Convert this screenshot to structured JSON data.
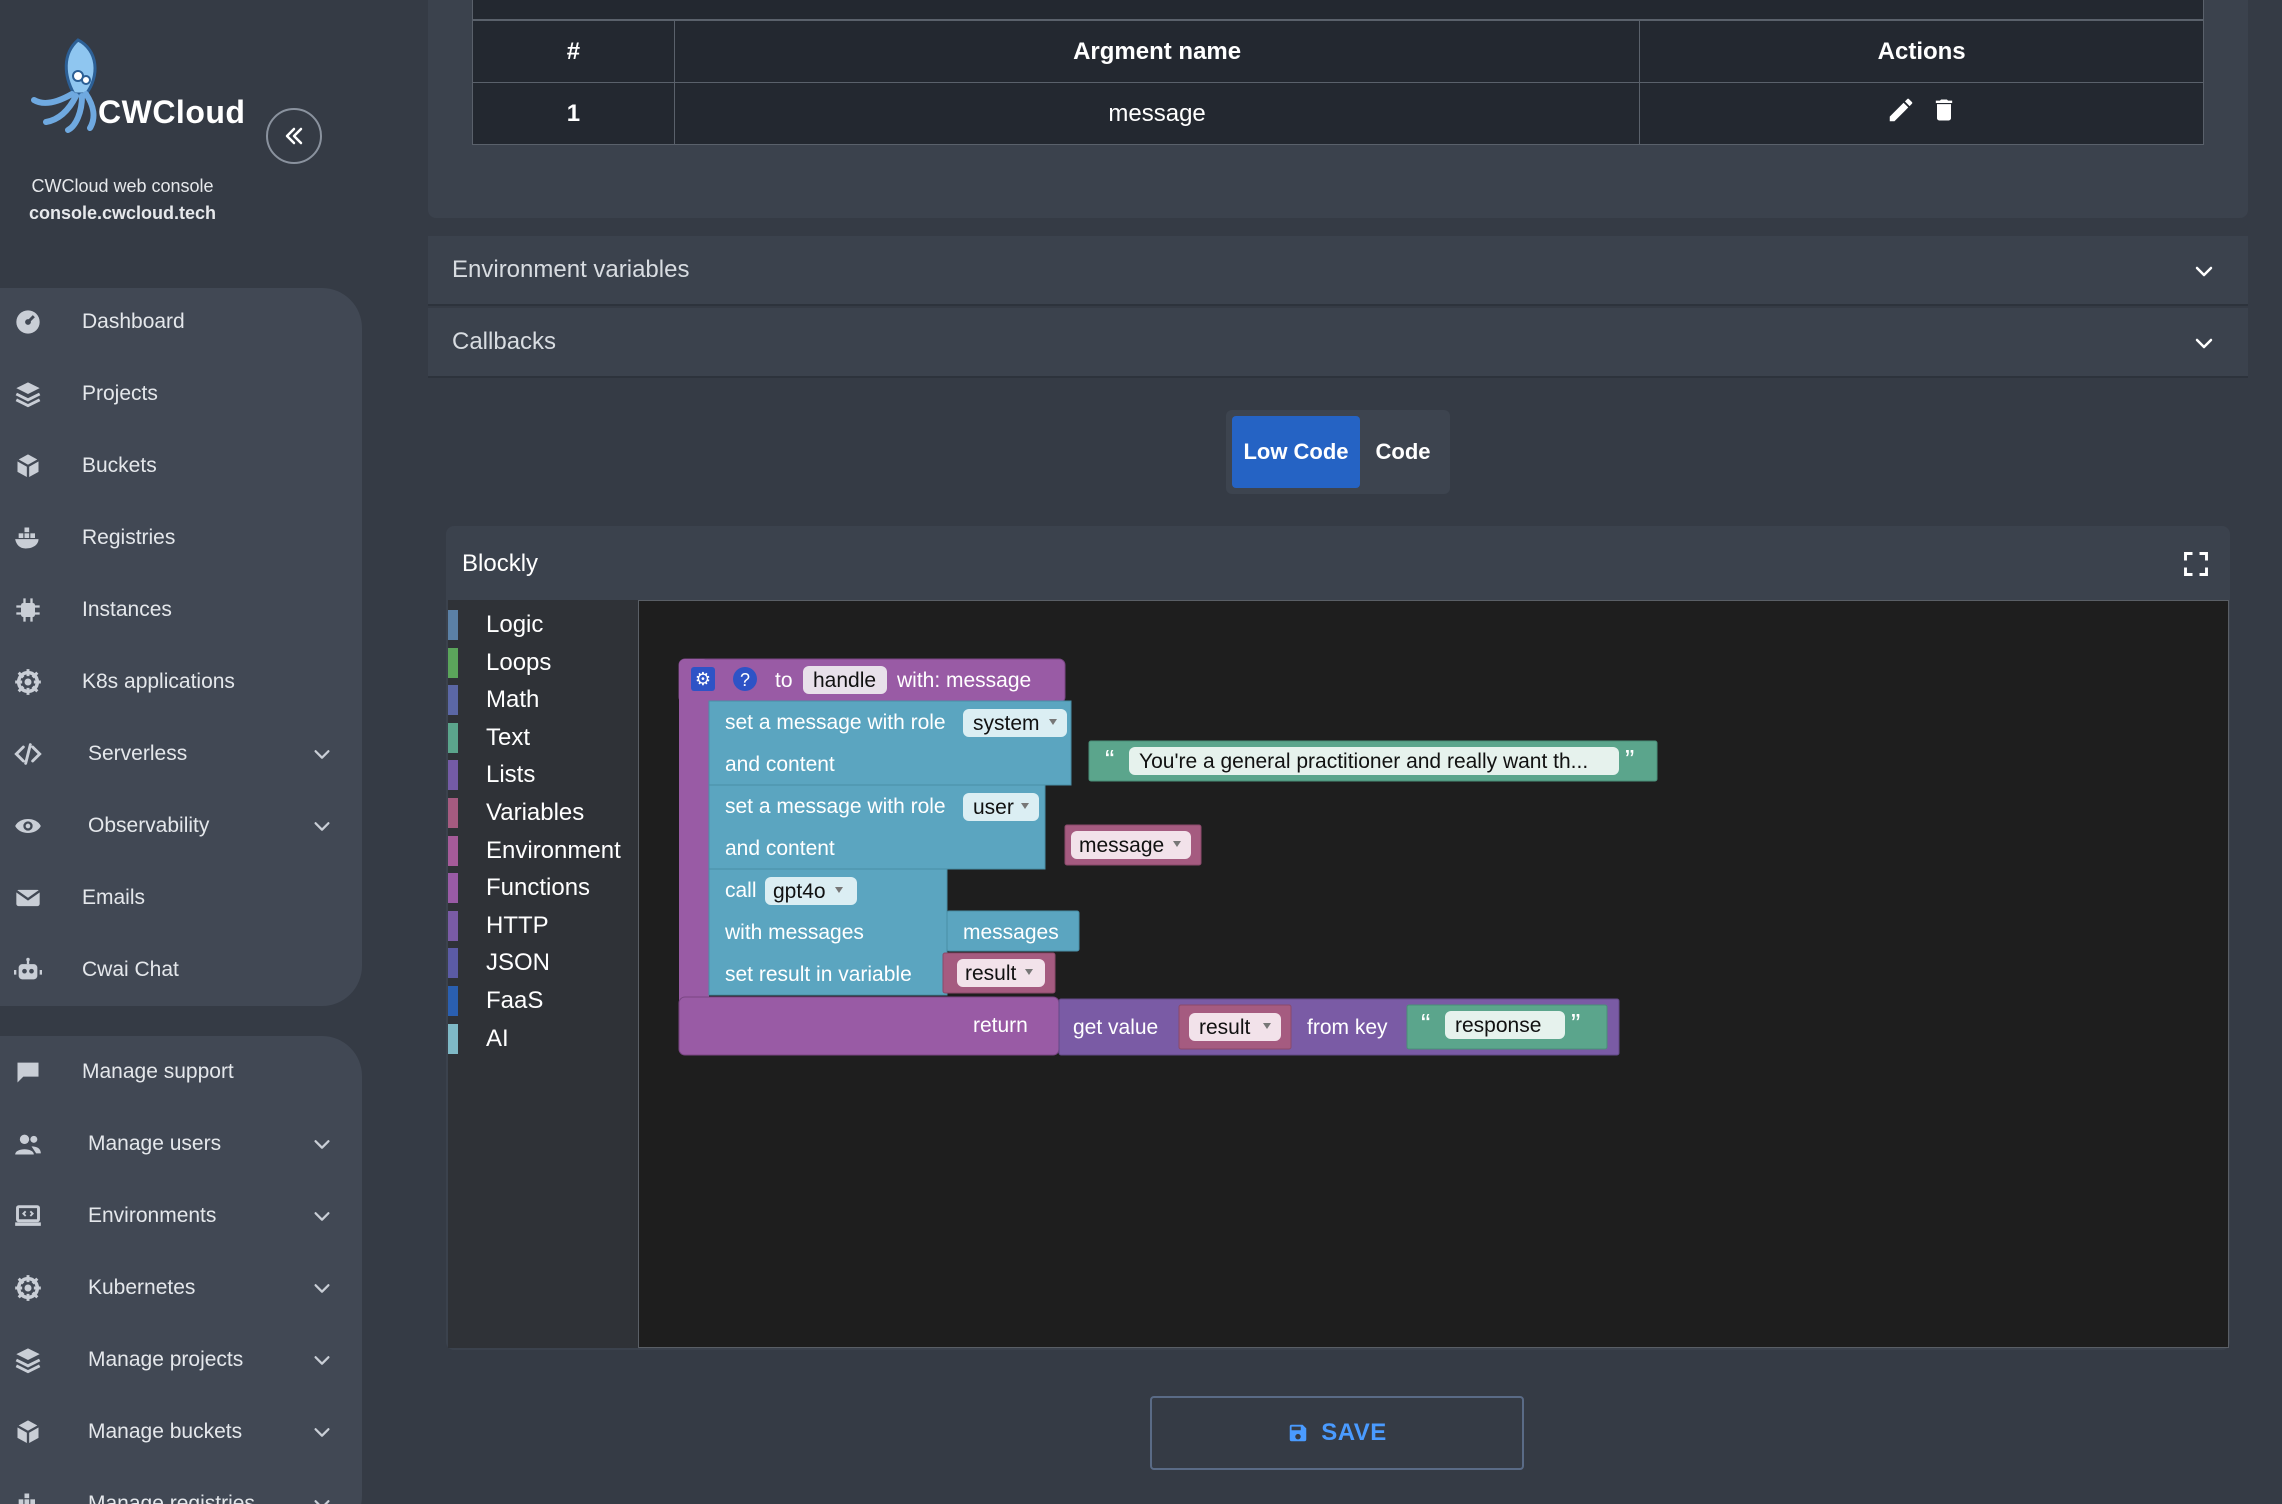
{
  "brand": {
    "logo_text": "CWCloud",
    "console_title": "CWCloud web console",
    "console_host": "console.cwcloud.tech"
  },
  "nav": {
    "group1": [
      {
        "label": "Dashboard",
        "icon": "dashboard-icon",
        "chevron": false
      },
      {
        "label": "Projects",
        "icon": "layers-icon",
        "chevron": false
      },
      {
        "label": "Buckets",
        "icon": "box-icon",
        "chevron": false
      },
      {
        "label": "Registries",
        "icon": "docker-icon",
        "chevron": false
      },
      {
        "label": "Instances",
        "icon": "chip-icon",
        "chevron": false
      },
      {
        "label": "K8s applications",
        "icon": "helm-icon",
        "chevron": false
      },
      {
        "label": "Serverless",
        "icon": "code-icon",
        "chevron": true
      },
      {
        "label": "Observability",
        "icon": "eye-icon",
        "chevron": true
      },
      {
        "label": "Emails",
        "icon": "mail-icon",
        "chevron": false
      },
      {
        "label": "Cwai Chat",
        "icon": "robot-icon",
        "chevron": false
      }
    ],
    "group2": [
      {
        "label": "Manage support",
        "icon": "chat-icon",
        "chevron": false
      },
      {
        "label": "Manage users",
        "icon": "users-icon",
        "chevron": true
      },
      {
        "label": "Environments",
        "icon": "laptop-code-icon",
        "chevron": true
      },
      {
        "label": "Kubernetes",
        "icon": "helm-icon",
        "chevron": true
      },
      {
        "label": "Manage projects",
        "icon": "layers-icon",
        "chevron": true
      },
      {
        "label": "Manage buckets",
        "icon": "box-icon",
        "chevron": true
      },
      {
        "label": "Manage registries",
        "icon": "docker-icon",
        "chevron": true
      }
    ]
  },
  "args_table": {
    "headers": [
      "#",
      "Argment name",
      "Actions"
    ],
    "rows": [
      {
        "index": "1",
        "name": "message"
      }
    ]
  },
  "accordions": {
    "env": "Environment variables",
    "callbacks": "Callbacks"
  },
  "mode_toggle": {
    "low_code": "Low Code",
    "code": "Code"
  },
  "blockly": {
    "title": "Blockly",
    "toolbox": [
      {
        "label": "Logic",
        "color": "#5b80a5"
      },
      {
        "label": "Loops",
        "color": "#5ba55b"
      },
      {
        "label": "Math",
        "color": "#5b67a5"
      },
      {
        "label": "Text",
        "color": "#5ba58c"
      },
      {
        "label": "Lists",
        "color": "#745ba5"
      },
      {
        "label": "Variables",
        "color": "#a55b80"
      },
      {
        "label": "Environment",
        "color": "#a55b99"
      },
      {
        "label": "Functions",
        "color": "#995ba5"
      },
      {
        "label": "HTTP",
        "color": "#7a5ba5"
      },
      {
        "label": "JSON",
        "color": "#5b5ba5"
      },
      {
        "label": "FaaS",
        "color": "#2a5fb0"
      },
      {
        "label": "AI",
        "color": "#7fb9c6"
      }
    ],
    "blocks": {
      "to": "to",
      "fn_name": "handle",
      "with": "with: message",
      "set_msg_role": "set a message with role",
      "role_system": "system",
      "and_content": "and content",
      "system_text": "You're a general practitioner and really want th...",
      "role_user": "user",
      "message_var": "message",
      "call": "call",
      "model": "gpt4o",
      "with_messages": "with messages",
      "messages": "messages",
      "set_result": "set result in variable",
      "result_var": "result",
      "return": "return",
      "get_value": "get value",
      "from_key": "from key",
      "key": "response"
    }
  },
  "save": {
    "label": "SAVE"
  }
}
